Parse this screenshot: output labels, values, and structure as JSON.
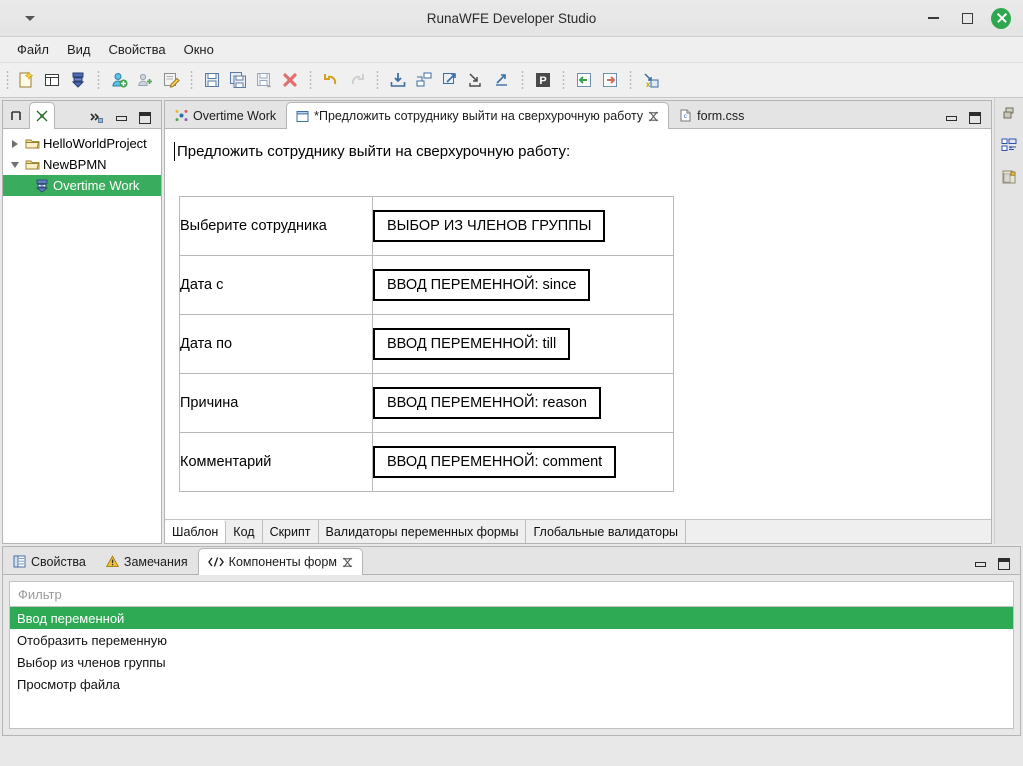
{
  "window": {
    "title": "RunaWFE Developer Studio",
    "menu_chevron_icon": "chevron-down-icon",
    "minimize_label": "Свернуть",
    "maximize_label": "Развернуть",
    "close_label": "Закрыть",
    "close_color": "#2ea84f"
  },
  "menubar": {
    "items": [
      {
        "label": "Файл"
      },
      {
        "label": "Вид"
      },
      {
        "label": "Свойства"
      },
      {
        "label": "Окно"
      }
    ]
  },
  "toolbar": {
    "groups": [
      {
        "buttons": [
          {
            "icon": "new-file-icon",
            "label": "Создать"
          },
          {
            "icon": "new-perspective-icon",
            "label": "Новая перспектива"
          },
          {
            "icon": "new-process-icon",
            "label": "Новый процесс"
          }
        ]
      },
      {
        "buttons": [
          {
            "icon": "add-users-icon",
            "label": "Добавить группу"
          },
          {
            "icon": "add-user-icon",
            "label": "Добавить пользователя"
          },
          {
            "icon": "edit-properties-icon",
            "label": "Редактировать свойства"
          }
        ]
      },
      {
        "buttons": [
          {
            "icon": "save-icon",
            "label": "Сохранить"
          },
          {
            "icon": "save-all-icon",
            "label": "Сохранить все"
          },
          {
            "icon": "save-as-icon",
            "label": "Сохранить как"
          },
          {
            "icon": "delete-icon",
            "label": "Удалить"
          }
        ]
      },
      {
        "buttons": [
          {
            "icon": "undo-icon",
            "label": "Отменить"
          },
          {
            "icon": "redo-icon",
            "label": "Повторить"
          }
        ]
      },
      {
        "buttons": [
          {
            "icon": "import-icon",
            "label": "Импорт"
          },
          {
            "icon": "deploy-icon",
            "label": "Развернуть"
          },
          {
            "icon": "export-icon",
            "label": "Экспорт"
          },
          {
            "icon": "import-par-icon",
            "label": "Импорт par"
          },
          {
            "icon": "export-par-icon",
            "label": "Экспорт par"
          }
        ]
      },
      {
        "buttons": [
          {
            "icon": "process-p-icon",
            "label": "P"
          }
        ]
      },
      {
        "buttons": [
          {
            "icon": "back-icon",
            "label": "Назад"
          },
          {
            "icon": "forward-icon",
            "label": "Вперёд"
          }
        ]
      },
      {
        "buttons": [
          {
            "icon": "xp-export-icon",
            "label": "Экспорт в XPDL"
          }
        ]
      }
    ]
  },
  "project_explorer": {
    "tabs": [
      {
        "label": "П",
        "icon": "project-explorer-icon",
        "active": false
      },
      {
        "label": "",
        "icon": "navigator-icon",
        "active": true
      }
    ],
    "overflow_icon": "chevron-double-right-icon",
    "minimize_icon": "minimize-icon",
    "maximize_icon": "maximize-icon",
    "tree": [
      {
        "label": "HelloWorldProject",
        "icon": "folder-icon",
        "expanded": false,
        "level": 0,
        "selected": false
      },
      {
        "label": "NewBPMN",
        "icon": "folder-icon",
        "expanded": true,
        "level": 0,
        "selected": false
      },
      {
        "label": "Overtime Work",
        "icon": "process-icon",
        "expanded": null,
        "level": 1,
        "selected": true
      }
    ]
  },
  "editor": {
    "tabs": [
      {
        "label": "Overtime Work",
        "icon": "process-diagram-icon",
        "active": false,
        "closable": false,
        "dirty": false
      },
      {
        "label": "*Предложить сотруднику выйти на сверхурочную работу",
        "icon": "form-icon",
        "active": true,
        "closable": true,
        "dirty": true
      },
      {
        "label": "form.css",
        "icon": "css-file-icon",
        "active": false,
        "closable": false,
        "dirty": false
      }
    ],
    "minimize_icon": "minimize-icon",
    "maximize_icon": "maximize-icon",
    "form": {
      "title": "Предложить сотруднику выйти на сверхурочную работу:",
      "rows": [
        {
          "label": "Выберите сотрудника",
          "widget": "ВЫБОР ИЗ ЧЛЕНОВ ГРУППЫ"
        },
        {
          "label": "Дата с",
          "widget": "ВВОД ПЕРЕМЕННОЙ: since"
        },
        {
          "label": "Дата по",
          "widget": "ВВОД ПЕРЕМЕННОЙ: till"
        },
        {
          "label": "Причина",
          "widget": "ВВОД ПЕРЕМЕННОЙ: reason"
        },
        {
          "label": "Комментарий",
          "widget": "ВВОД ПЕРЕМЕННОЙ: comment"
        }
      ]
    },
    "bottom_tabs": [
      {
        "label": "Шаблон",
        "active": true
      },
      {
        "label": "Код",
        "active": false
      },
      {
        "label": "Скрипт",
        "active": false
      },
      {
        "label": "Валидаторы переменных формы",
        "active": false
      },
      {
        "label": "Глобальные валидаторы",
        "active": false
      }
    ]
  },
  "bottom_panel": {
    "tabs": [
      {
        "label": "Свойства",
        "icon": "properties-icon",
        "active": false,
        "closable": false
      },
      {
        "label": "Замечания",
        "icon": "warning-icon",
        "active": false,
        "closable": false
      },
      {
        "label": "Компоненты форм",
        "icon": "form-components-icon",
        "active": true,
        "closable": true
      }
    ],
    "minimize_icon": "minimize-icon",
    "maximize_icon": "maximize-icon",
    "filter": {
      "value": "",
      "placeholder": "Фильтр"
    },
    "components": [
      {
        "label": "Ввод переменной",
        "selected": true
      },
      {
        "label": "Отобразить переменную",
        "selected": false
      },
      {
        "label": "Выбор из членов группы",
        "selected": false
      },
      {
        "label": "Просмотр файла",
        "selected": false
      }
    ],
    "selection_color": "#2eaa54"
  },
  "right_rail": {
    "buttons": [
      {
        "icon": "restore-perspective-icon",
        "label": "Восстановить"
      },
      {
        "icon": "outline-view-icon",
        "label": "Структура"
      },
      {
        "icon": "properties-view-icon",
        "label": "Свойства"
      }
    ]
  }
}
